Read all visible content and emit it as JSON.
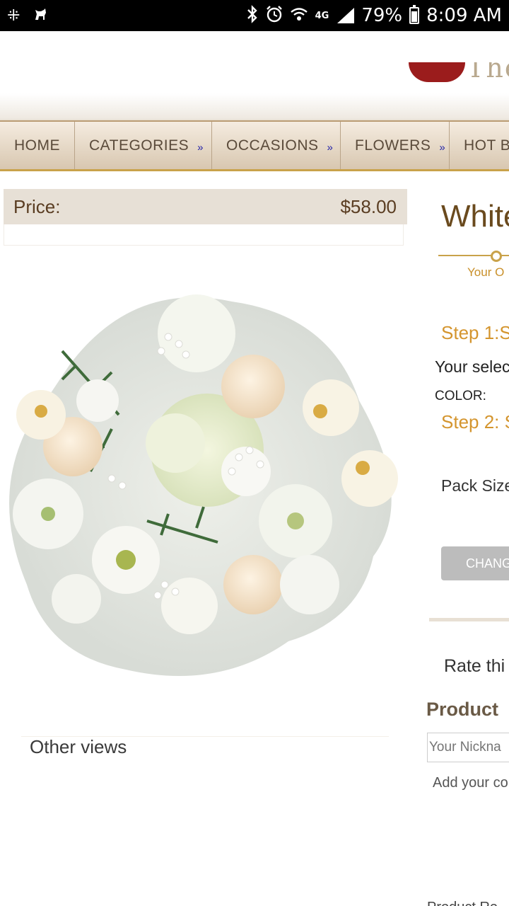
{
  "status_bar": {
    "battery": "79%",
    "time": "8:09 AM",
    "network": "4G",
    "icons": [
      "app-grid-icon",
      "cat-icon",
      "bluetooth-icon",
      "alarm-icon",
      "wifi-icon",
      "signal-icon",
      "battery-icon"
    ]
  },
  "header": {
    "logo_text": "The"
  },
  "nav": {
    "items": [
      {
        "label": "HOME"
      },
      {
        "label": "CATEGORIES",
        "arrow": "»"
      },
      {
        "label": "OCCASIONS",
        "arrow": "»"
      },
      {
        "label": "FLOWERS",
        "arrow": "»"
      },
      {
        "label": "HOT B"
      }
    ]
  },
  "price": {
    "label": "Price:",
    "value": "$58.00"
  },
  "product": {
    "title": "White",
    "progress_label": "Your O",
    "step1": "Step 1:S",
    "selection": "Your selec",
    "color_label": "COLOR:",
    "step2": "Step 2: S",
    "pack_size": "Pack Size",
    "change_button": "CHANG",
    "rate_label": "Rate thi",
    "review_heading": "Product",
    "nickname_placeholder": "Your Nickna",
    "add_comment": "Add your co",
    "bottom_text": "Product Re"
  },
  "other_views": "Other views",
  "colors": {
    "accent_gold": "#c9a24a",
    "title_brown": "#6a4a1e",
    "step_orange": "#d4952e",
    "price_bg": "#e7e0d6"
  }
}
